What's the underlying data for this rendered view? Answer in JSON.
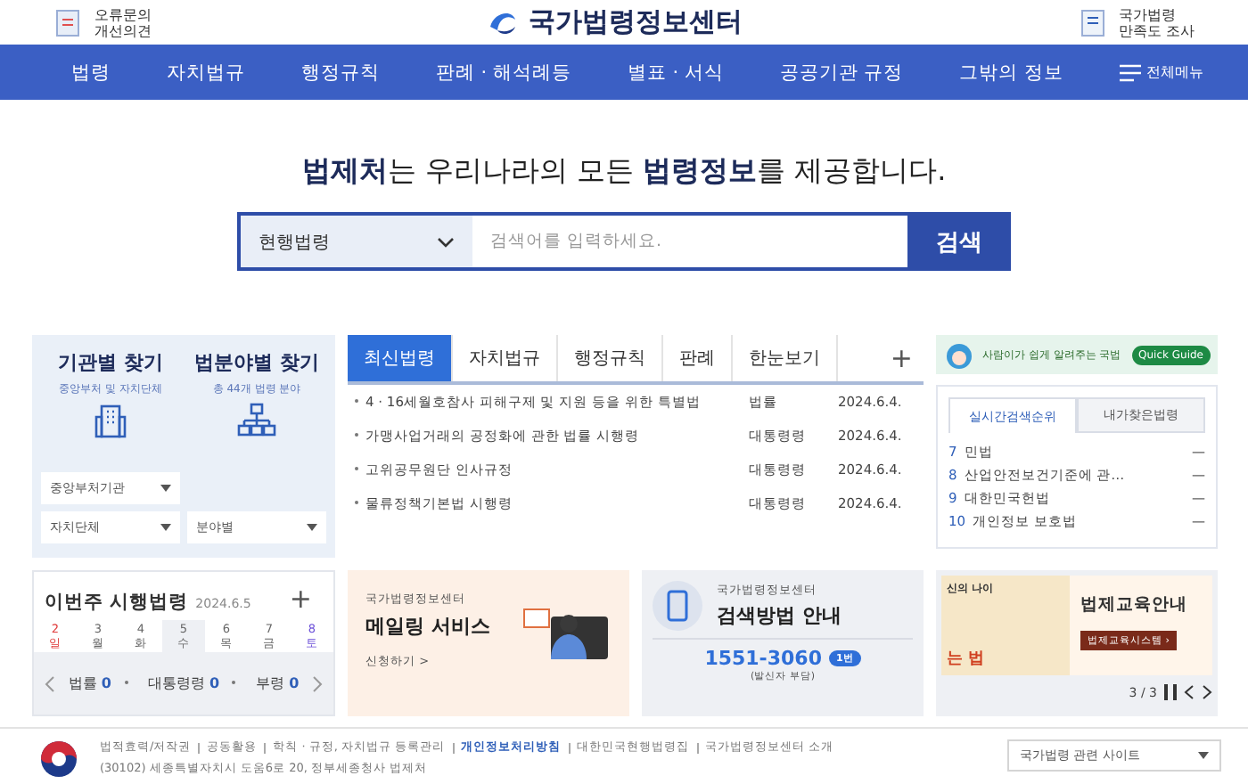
{
  "header": {
    "feedback": [
      "오류문의",
      "개선의견"
    ],
    "logo": "국가법령정보센터",
    "survey": [
      "국가법령",
      "만족도 조사"
    ]
  },
  "nav": {
    "items": [
      "법령",
      "자치법규",
      "행정규칙",
      "판례 · 해석례등",
      "별표 · 서식",
      "공공기관 규정",
      "그밖의 정보"
    ],
    "all_menu": "전체메뉴"
  },
  "headline": "**법제처**는 우리나라의 모든 **법령정보**를 제공합니다.",
  "search": {
    "scope": "현행법령",
    "placeholder": "검색어를 입력하세요.",
    "button": "검색"
  },
  "finders": [
    {
      "title": "기관별 찾기",
      "subtitle": "중앙부처 및 자치단체",
      "kind": "building",
      "selects": [
        "중앙부처기관",
        "자치단체"
      ]
    },
    {
      "title": "법분야별 찾기",
      "subtitle": "총 44개 법령 분야",
      "kind": "tree",
      "selects": [
        "분야별"
      ]
    }
  ],
  "news": {
    "tabs": [
      {
        "label": "최신법령",
        "selected": true
      },
      {
        "label": "자치법규",
        "selected": false
      },
      {
        "label": "행정규칙",
        "selected": false
      },
      {
        "label": "판례",
        "selected": false
      },
      {
        "label": "한눈보기",
        "selected": false
      }
    ],
    "more": "+",
    "rows": [
      {
        "title": "4 · 16세월호참사 피해구제 및 지원 등을 위한 특별법",
        "type": "법률",
        "date": "2024.6.4."
      },
      {
        "title": "가맹사업거래의 공정화에 관한 법률 시행령",
        "type": "대통령령",
        "date": "2024.6.4."
      },
      {
        "title": "고위공무원단 인사규정",
        "type": "대통령령",
        "date": "2024.6.4."
      },
      {
        "title": "물류정책기본법 시행령",
        "type": "대통령령",
        "date": "2024.6.4."
      }
    ]
  },
  "quick_guide": {
    "text": "사람이가 쉽게 알려주는 국법",
    "badge": "Quick Guide"
  },
  "ranking": {
    "tabs": [
      {
        "label": "실시간검색순위",
        "selected": true
      },
      {
        "label": "내가찾은법령",
        "selected": false
      }
    ],
    "items": [
      {
        "rank": "7",
        "name": "민법",
        "change": "—"
      },
      {
        "rank": "8",
        "name": "산업안전보건기준에 관…",
        "change": "—"
      },
      {
        "rank": "9",
        "name": "대한민국헌법",
        "change": "—"
      },
      {
        "rank": "10",
        "name": "개인정보 보호법",
        "change": "—"
      }
    ]
  },
  "week": {
    "title": "이번주 시행법령",
    "date": "2024.6.5",
    "more": "+",
    "days": [
      {
        "num": "2",
        "dow": "일",
        "kind": "sun",
        "selected": false
      },
      {
        "num": "3",
        "dow": "월",
        "kind": "weekday",
        "selected": false
      },
      {
        "num": "4",
        "dow": "화",
        "kind": "weekday",
        "selected": false
      },
      {
        "num": "5",
        "dow": "수",
        "kind": "weekday",
        "selected": true
      },
      {
        "num": "6",
        "dow": "목",
        "kind": "weekday",
        "selected": false
      },
      {
        "num": "7",
        "dow": "금",
        "kind": "weekday",
        "selected": false
      },
      {
        "num": "8",
        "dow": "토",
        "kind": "sat",
        "selected": false
      }
    ],
    "counts": [
      {
        "label": "법률",
        "value": "0"
      },
      {
        "label": "대통령령",
        "value": "0"
      },
      {
        "label": "부령",
        "value": "0"
      }
    ]
  },
  "mailing": {
    "org": "국가법령정보센터",
    "title": "메일링 서비스",
    "link": "신청하기 >"
  },
  "guide": {
    "org": "국가법령정보센터",
    "title": "검색방법 안내",
    "phone": "1551-3060",
    "badge": "1번",
    "note": "(발신자 부담)"
  },
  "banner": {
    "art_top": "신의 나이",
    "art_bottom": "는 법",
    "title": "법제교육안내",
    "button": "법제교육시스템 ›",
    "pager": "3 / 3"
  },
  "footer": {
    "links": [
      {
        "text": "법적효력/저작권",
        "bold": false
      },
      {
        "text": "공동활용",
        "bold": false
      },
      {
        "text": "학칙 · 규정, 자치법규 등록관리",
        "bold": false
      },
      {
        "text": "개인정보처리방침",
        "bold": true
      },
      {
        "text": "대한민국현행법령집",
        "bold": false
      },
      {
        "text": "국가법령정보센터 소개",
        "bold": false
      }
    ],
    "address": "(30102) 세종특별자치시 도움6로 20, 정부세종청사 법제처",
    "site_select": "국가법령 관련 사이트"
  }
}
